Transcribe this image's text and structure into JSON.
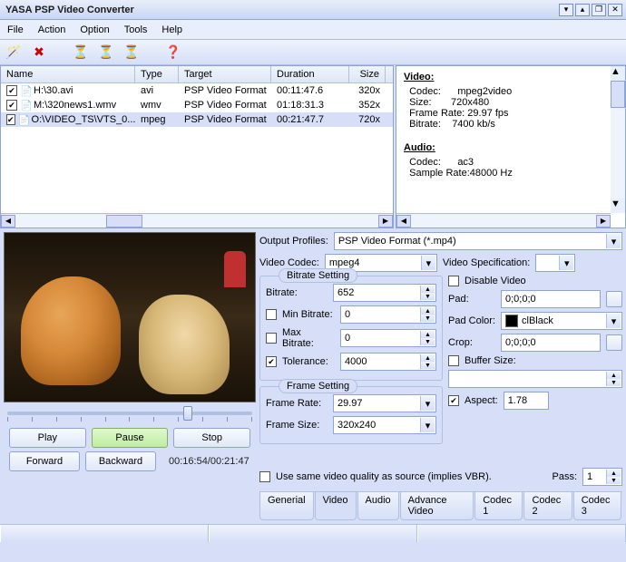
{
  "window": {
    "title": "YASA PSP Video Converter"
  },
  "menu": {
    "file": "File",
    "action": "Action",
    "option": "Option",
    "tools": "Tools",
    "help": "Help"
  },
  "columns": {
    "name": "Name",
    "type": "Type",
    "target": "Target",
    "duration": "Duration",
    "size": "Size"
  },
  "files": [
    {
      "name": "H:\\30.avi",
      "type": "avi",
      "target": "PSP Video Format",
      "duration": "00:11:47.6",
      "size": "320x"
    },
    {
      "name": "M:\\320news1.wmv",
      "type": "wmv",
      "target": "PSP Video Format",
      "duration": "01:18:31.3",
      "size": "352x"
    },
    {
      "name": "O:\\VIDEO_TS\\VTS_0...",
      "type": "mpeg",
      "target": "PSP Video Format",
      "duration": "00:21:47.7",
      "size": "720x"
    }
  ],
  "info": {
    "video_h": "Video:",
    "codec_l": "  Codec:      ",
    "codec_v": "mpeg2video",
    "size_l": "  Size:       ",
    "size_v": "720x480",
    "fr_l": "  Frame Rate: ",
    "fr_v": "29.97 fps",
    "br_l": "  Bitrate:    ",
    "br_v": "7400 kb/s",
    "audio_h": "Audio:",
    "acodec_l": "  Codec:      ",
    "acodec_v": "ac3",
    "asr_l": "  Sample Rate:",
    "asr_v": "48000 Hz"
  },
  "controls": {
    "play": "Play",
    "pause": "Pause",
    "stop": "Stop",
    "forward": "Forward",
    "backward": "Backward",
    "timecode": "00:16:54/00:21:47"
  },
  "profiles": {
    "label": "Output Profiles:",
    "value": "PSP Video Format (*.mp4)"
  },
  "vcodec": {
    "label": "Video Codec:",
    "value": "mpeg4",
    "spec_label": "Video Specification:"
  },
  "bitrate_group": {
    "title": "Bitrate Setting",
    "bitrate_l": "Bitrate:",
    "bitrate_v": "652",
    "min_l": "Min Bitrate:",
    "min_v": "0",
    "max_l": "Max Bitrate:",
    "max_v": "0",
    "tol_l": "Tolerance:",
    "tol_v": "4000"
  },
  "frame_group": {
    "title": "Frame Setting",
    "rate_l": "Frame Rate:",
    "rate_v": "29.97",
    "size_l": "Frame Size:",
    "size_v": "320x240"
  },
  "right": {
    "disable": "Disable Video",
    "pad_l": "Pad:",
    "pad_v": "0;0;0;0",
    "padcolor_l": "Pad Color:",
    "padcolor_v": "clBlack",
    "crop_l": "Crop:",
    "crop_v": "0;0;0;0",
    "buffer_l": "Buffer Size:",
    "aspect_l": "Aspect:",
    "aspect_v": "1.78"
  },
  "vbr": {
    "label": "Use same video quality as source (implies VBR).",
    "pass_l": "Pass:",
    "pass_v": "1"
  },
  "tabs": {
    "general": "Generial",
    "video": "Video",
    "audio": "Audio",
    "adv": "Advance Video",
    "c1": "Codec 1",
    "c2": "Codec 2",
    "c3": "Codec 3"
  }
}
